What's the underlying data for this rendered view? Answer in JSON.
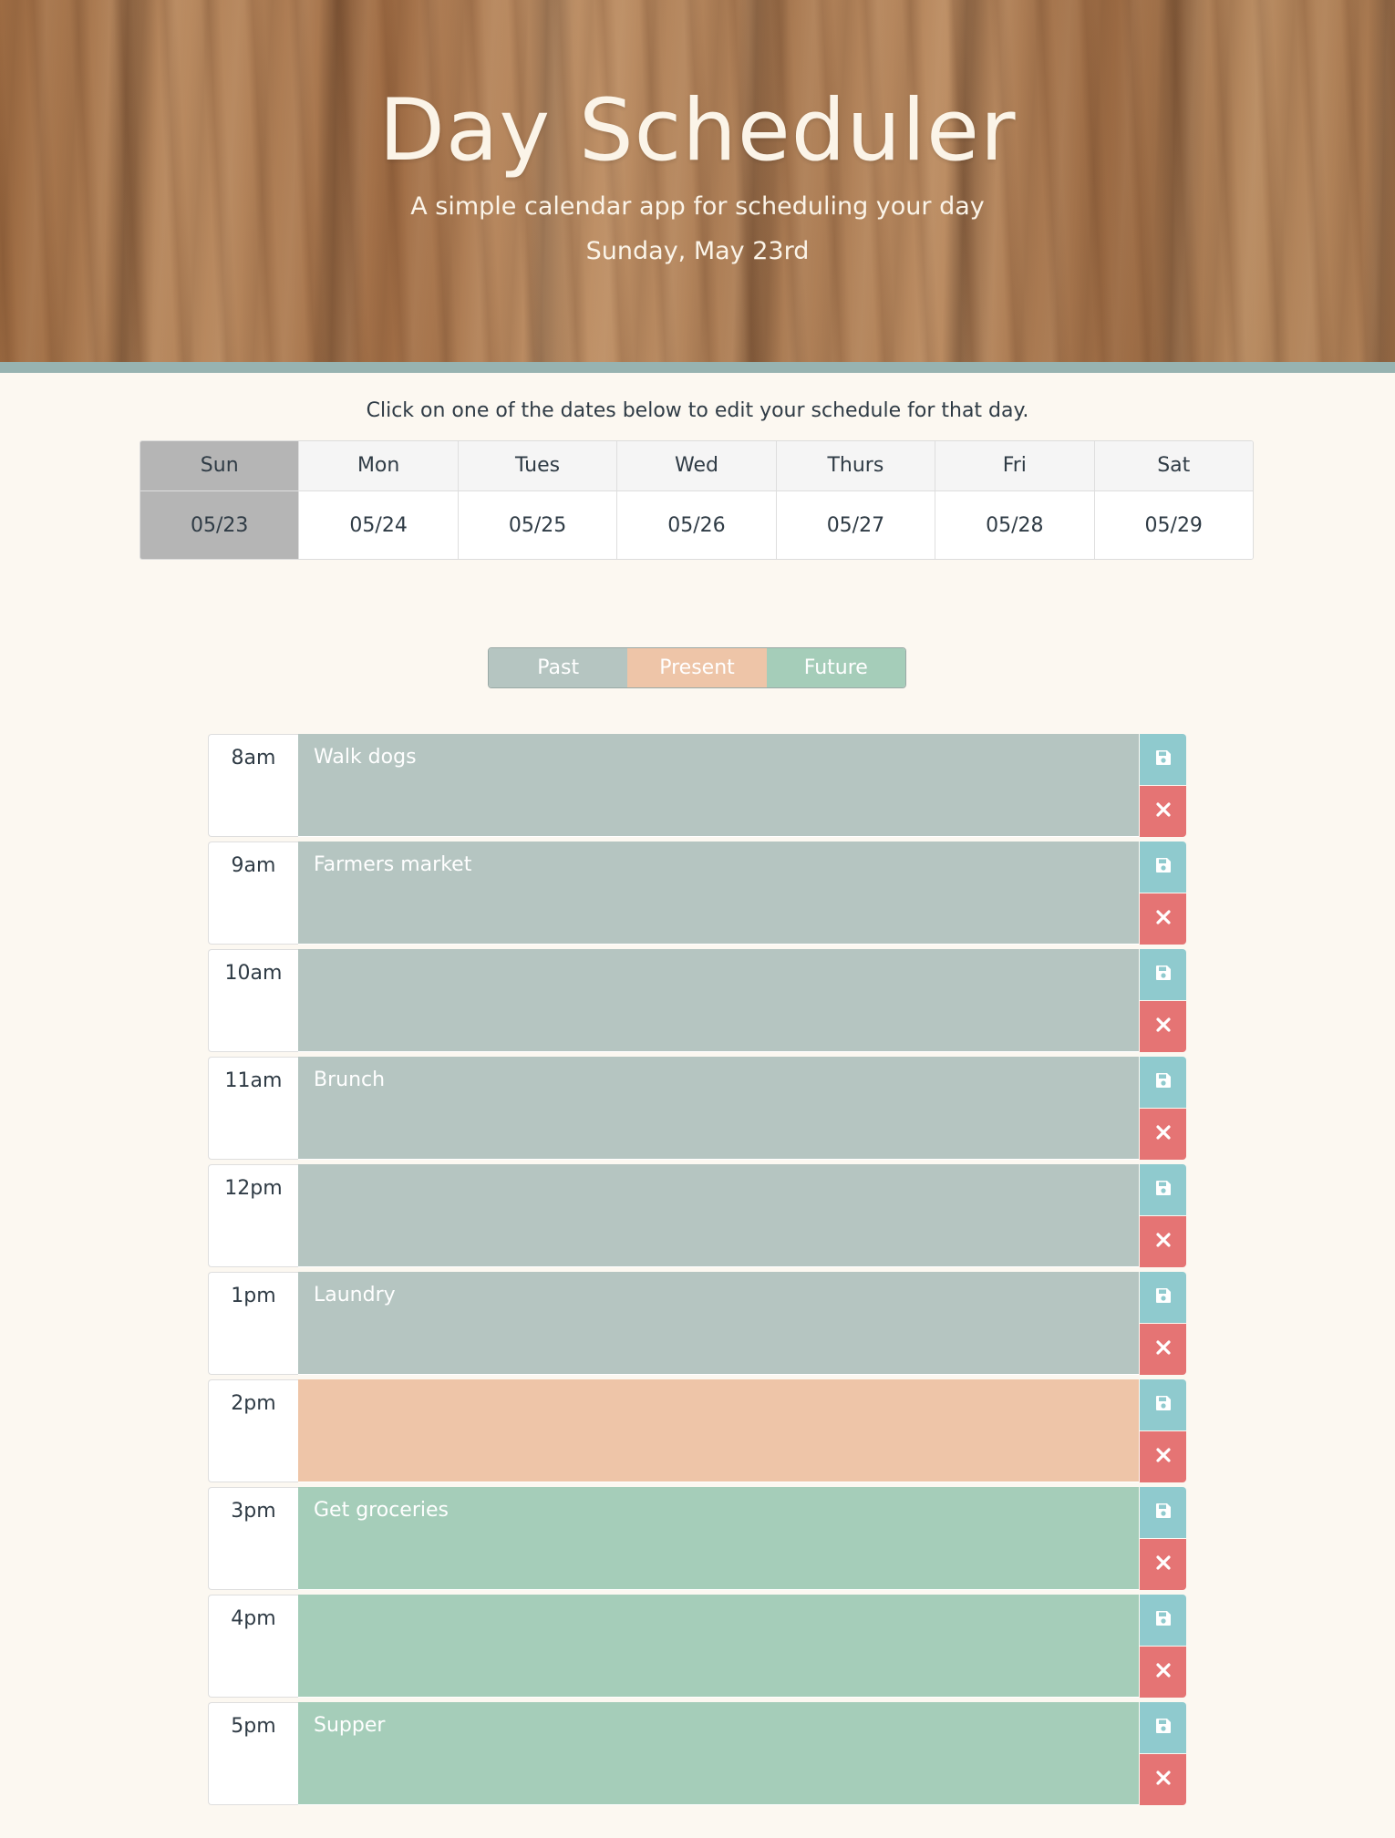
{
  "header": {
    "title": "Day Scheduler",
    "subtitle": "A simple calendar app for scheduling your day",
    "current_date": "Sunday, May 23rd"
  },
  "instructions": "Click on one of the dates below to edit your schedule for that day.",
  "week": [
    {
      "day": "Sun",
      "date": "05/23",
      "selected": true
    },
    {
      "day": "Mon",
      "date": "05/24",
      "selected": false
    },
    {
      "day": "Tues",
      "date": "05/25",
      "selected": false
    },
    {
      "day": "Wed",
      "date": "05/26",
      "selected": false
    },
    {
      "day": "Thurs",
      "date": "05/27",
      "selected": false
    },
    {
      "day": "Fri",
      "date": "05/28",
      "selected": false
    },
    {
      "day": "Sat",
      "date": "05/29",
      "selected": false
    }
  ],
  "legend": {
    "past": "Past",
    "present": "Present",
    "future": "Future"
  },
  "colors": {
    "past": "#b5c5c1",
    "present": "#eec5a8",
    "future": "#a5cdb9",
    "save": "#8fcace",
    "delete": "#e57474",
    "selected_day": "#b5b5b5"
  },
  "icons": {
    "save": "save-icon",
    "delete": "close-icon"
  },
  "schedule": [
    {
      "hour": "8am",
      "task": "Walk dogs",
      "status": "past"
    },
    {
      "hour": "9am",
      "task": "Farmers market",
      "status": "past"
    },
    {
      "hour": "10am",
      "task": "",
      "status": "past"
    },
    {
      "hour": "11am",
      "task": "Brunch",
      "status": "past"
    },
    {
      "hour": "12pm",
      "task": "",
      "status": "past"
    },
    {
      "hour": "1pm",
      "task": "Laundry",
      "status": "past"
    },
    {
      "hour": "2pm",
      "task": "",
      "status": "present"
    },
    {
      "hour": "3pm",
      "task": "Get groceries",
      "status": "future"
    },
    {
      "hour": "4pm",
      "task": "",
      "status": "future"
    },
    {
      "hour": "5pm",
      "task": "Supper",
      "status": "future"
    }
  ]
}
